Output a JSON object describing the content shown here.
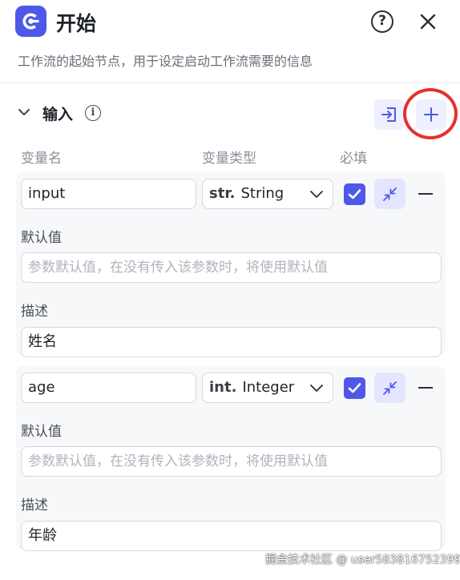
{
  "header": {
    "title": "开始",
    "subtitle": "工作流的起始节点，用于设定启动工作流需要的信息",
    "help_label": "?",
    "logo_icon": "start-node-icon",
    "accent": "#4e58e8"
  },
  "input_section": {
    "title": "输入",
    "info_label": "i",
    "columns": {
      "name": "变量名",
      "type": "变量类型",
      "required": "必填"
    },
    "variables": [
      {
        "name": "input",
        "type_prefix": "str.",
        "type": "String",
        "required": true,
        "default_label": "默认值",
        "default_placeholder": "参数默认值，在没有传入该参数时，将使用默认值",
        "desc_label": "描述",
        "description": "姓名"
      },
      {
        "name": "age",
        "type_prefix": "int.",
        "type": "Integer",
        "required": true,
        "default_label": "默认值",
        "default_placeholder": "参数默认值，在没有传入该参数时，将使用默认值",
        "desc_label": "描述",
        "description": "年龄"
      }
    ]
  },
  "watermark": "掘金技术社区 @ user5838167523996",
  "colors": {
    "accent": "#4e58e8",
    "accent_light": "#eef0ff",
    "annotation": "#e5302e"
  }
}
